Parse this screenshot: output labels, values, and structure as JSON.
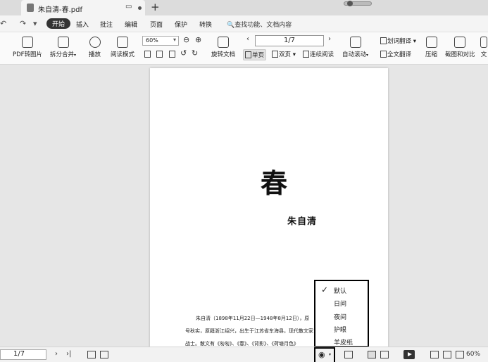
{
  "tab": {
    "title": "朱自清-春.pdf",
    "monitor_icon": "▭",
    "new_tab": "+"
  },
  "menubar": {
    "nav": [
      "↶",
      "↷",
      "▾"
    ],
    "items": [
      "开始",
      "插入",
      "批注",
      "编辑",
      "页面",
      "保护",
      "转换"
    ],
    "search": "🔍查找功能、文档内容"
  },
  "ribbon": {
    "pdf_to_image": "PDF转图片",
    "split_merge": "拆分合并",
    "play": "播放",
    "read_mode": "阅读模式",
    "zoom": "60%",
    "zoom_in": "⊕",
    "zoom_out": "⊖",
    "rotate": "旋转文档",
    "page_indicator": "1/7",
    "prev": "‹",
    "next": "›",
    "single_page": "单页",
    "double_page": "双页",
    "continuous": "连续阅读",
    "auto_scroll": "自动滚动",
    "translate_word": "划词翻译",
    "translate_full": "全文翻译",
    "compress": "压缩",
    "screenshot_compare": "截图和对比",
    "more": "文"
  },
  "document": {
    "title": "春",
    "author": "朱自清",
    "bio_lines": [
      "朱自清（1898年11月22日—1948年8月12日），原",
      "号秋实，原籍浙江绍兴，出生于江苏省东海县，现代散文家，",
      "战士。散文有《匆匆》、《春》、《背影》、《荷塘月色》"
    ]
  },
  "dropdown": {
    "check": "✓",
    "items": [
      "默认",
      "日间",
      "夜间",
      "护眼",
      "羊皮纸"
    ]
  },
  "statusbar": {
    "page": "1/7",
    "next": "›",
    "last": "›|",
    "zoom": "60%"
  }
}
